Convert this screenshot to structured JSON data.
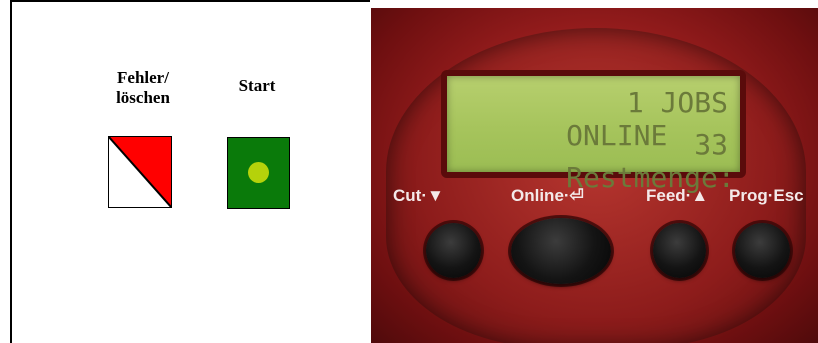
{
  "diagram": {
    "error_button": {
      "label": "Fehler/\nlöschen",
      "colors": {
        "fill": "#ff0000",
        "background": "#ffffff"
      }
    },
    "start_button": {
      "label": "Start",
      "colors": {
        "fill": "#0a7a0a",
        "led": "#b5d20b"
      }
    }
  },
  "printer_panel": {
    "lcd": {
      "line1_left": "ONLINE",
      "line1_right": "1 JOBS",
      "line2_left": "Restmenge:",
      "line2_right": "33"
    },
    "keys": [
      {
        "label": "Cut·▼",
        "icon": "arrow-down-icon"
      },
      {
        "label": "Online·⏎",
        "icon": "enter-icon"
      },
      {
        "label": "Feed·▲",
        "icon": "arrow-up-icon"
      },
      {
        "label": "Prog·Esc",
        "icon": ""
      }
    ]
  }
}
